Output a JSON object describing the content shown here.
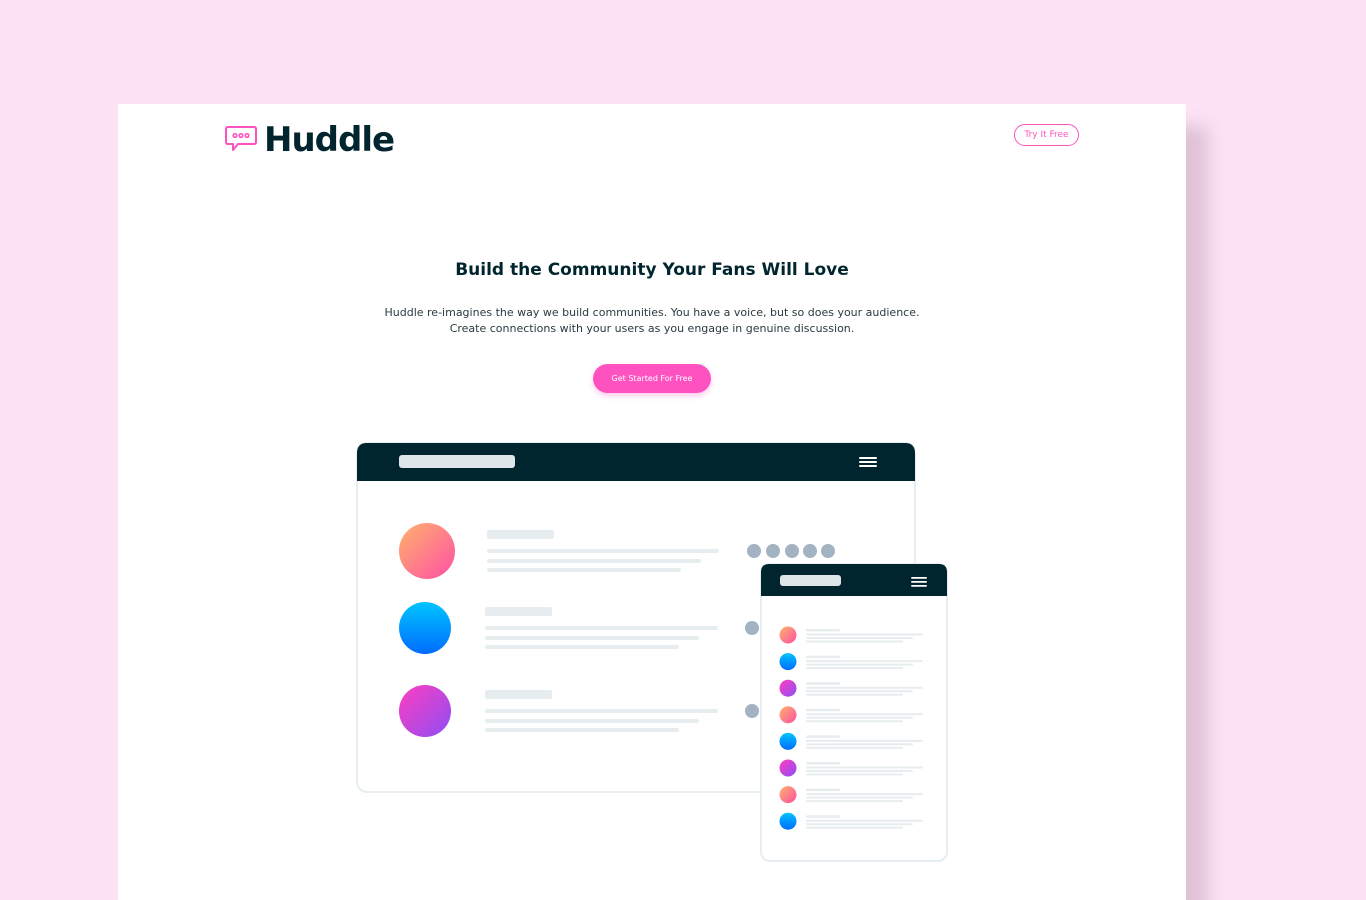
{
  "brand": {
    "name": "Huddle",
    "icon": "chat-bubble-icon",
    "accent": "#ff52c1",
    "dark": "#00252e",
    "background": "#fce2f4"
  },
  "header": {
    "cta_label": "Try It Free"
  },
  "hero": {
    "title": "Build the Community Your Fans Will Love",
    "description": "Huddle re-imagines the way we build communities. You have a voice, but so does your audience. Create connections with your users as you engage in genuine discussion.",
    "cta_label": "Get Started For Free"
  },
  "illustration": {
    "desktop_rows": [
      {
        "avatar": "orange-gradient-avatar",
        "reactions": 5
      },
      {
        "avatar": "blue-gradient-avatar",
        "reactions": 1
      },
      {
        "avatar": "purple-gradient-avatar",
        "reactions": 1
      }
    ],
    "mobile_rows": [
      "orange-gradient-avatar",
      "blue-gradient-avatar",
      "purple-gradient-avatar",
      "orange-gradient-avatar",
      "blue-gradient-avatar",
      "purple-gradient-avatar",
      "orange-gradient-avatar",
      "blue-gradient-avatar"
    ]
  }
}
